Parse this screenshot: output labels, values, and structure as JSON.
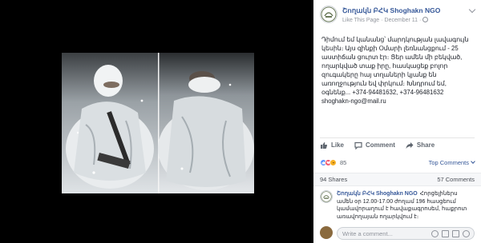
{
  "page": {
    "name": "Շողակն ԲՀԿ Shoghakn NGO",
    "like_action": "Like This Page",
    "date": "December 11"
  },
  "post": {
    "text": "Դիմում եմ կանանց՝ մարդկության լավագույն կեսին։ Այս զինքի Օմարի լեռնանցքում - 25 աստիճան ցուրտ էր։ Ցեր ամեն մի բեկված, ողարկված տաք իրը, հասկացեք բոլոր զուգակերը հայ տղաների կյանք են առողջություն եվ փրկում։ Խնդրում եմ, օգնենք... +374-94481632, +374-96481632 shoghakn-ngo@mail.ru"
  },
  "actions": {
    "like": "Like",
    "comment": "Comment",
    "share": "Share"
  },
  "reactions": {
    "count": "85",
    "top_comments": "Top Comments"
  },
  "counts": {
    "shares": "94 Shares",
    "comments": "57 Comments"
  },
  "comment": {
    "author": "Շողակն ԲՀԿ Shoghakn NGO",
    "text": "Հորցելիներս ամեն օր 12.00-17.00 ժողամ 196 հասցեում կամավորաղում է հավաքագրոսեմ, հաքրոտ առավողայան ողարկվում է։"
  },
  "composer": {
    "placeholder": "Write a comment..."
  },
  "colors": {
    "link": "#365899",
    "like_blue": "#5890ff",
    "love_red": "#f25268",
    "haha_yellow": "#f7b125"
  }
}
